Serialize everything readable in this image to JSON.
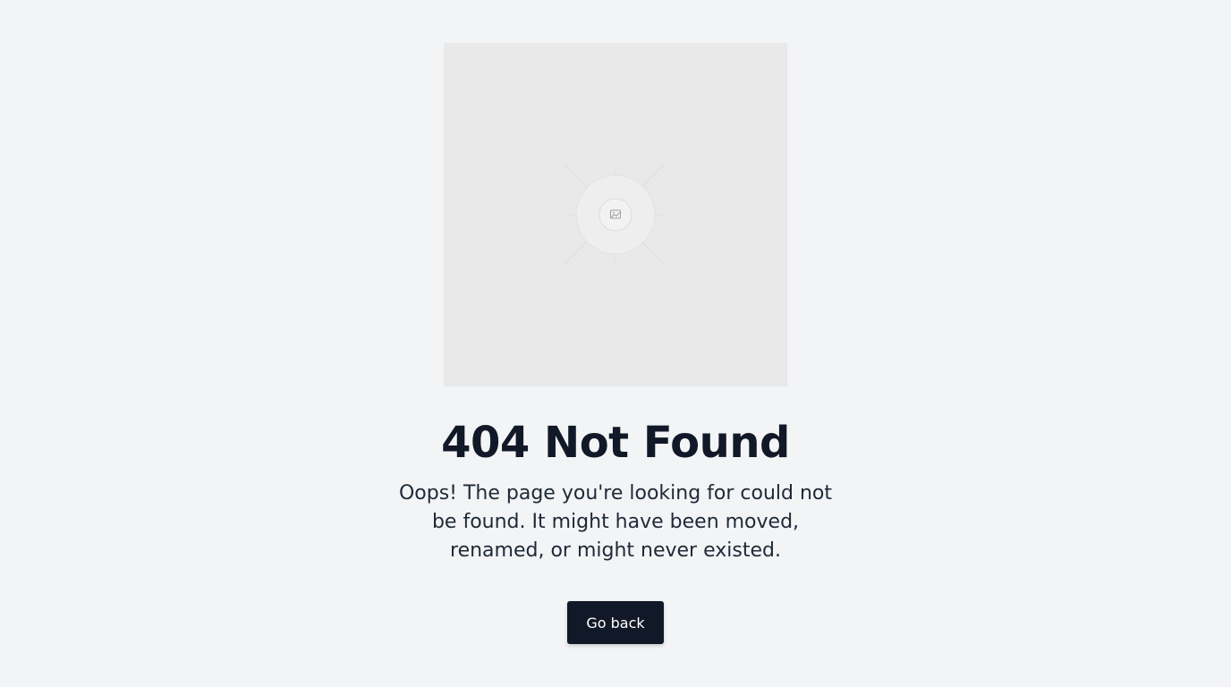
{
  "illustration": {
    "icon": "image-placeholder-icon",
    "background_color": "#e9e9e9"
  },
  "title": "404 Not Found",
  "message": "Oops! The page you're looking for could not be found. It might have been moved, renamed, or might never existed.",
  "actions": {
    "back_label": "Go back"
  },
  "colors": {
    "page_background": "#f2f4f6",
    "text_primary": "#111827",
    "button_background": "#111827",
    "button_text": "#ffffff"
  }
}
